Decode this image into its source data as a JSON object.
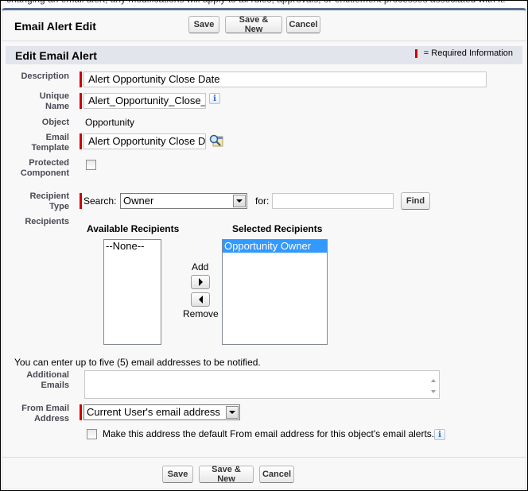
{
  "intro_text": "changing an email alert, any modifications will apply to all rules, approvals, or entitlement processes associated with it.",
  "page_block": {
    "title": "Email Alert Edit",
    "buttons": {
      "save": "Save",
      "save_new": "Save & New",
      "cancel": "Cancel"
    }
  },
  "section": {
    "title": "Edit Email Alert",
    "required_legend": "= Required Information"
  },
  "fields": {
    "description": {
      "label": "Description",
      "value": "Alert Opportunity Close Date",
      "required": true
    },
    "unique_name": {
      "label_line1": "Unique",
      "label_line2": "Name",
      "value": "Alert_Opportunity_Close_",
      "required": true,
      "info_icon": "i"
    },
    "object": {
      "label": "Object",
      "value": "Opportunity"
    },
    "email_template": {
      "label_line1": "Email",
      "label_line2": "Template",
      "value": "Alert Opportunity Close D",
      "required": true
    },
    "protected_component": {
      "label_line1": "Protected",
      "label_line2": "Component",
      "checked": false
    },
    "recipient_type": {
      "label_line1": "Recipient",
      "label_line2": "Type",
      "required": true,
      "search_label": "Search:",
      "search_value": "Owner",
      "for_label": "for:",
      "for_value": "",
      "find_button": "Find"
    },
    "recipients": {
      "label": "Recipients",
      "available_header": "Available Recipients",
      "available_options": [
        "--None--"
      ],
      "add_label": "Add",
      "remove_label": "Remove",
      "selected_header": "Selected Recipients",
      "selected_options": [
        "Opportunity Owner"
      ]
    },
    "additional_emails": {
      "hint": "You can enter up to five (5) email addresses to be notified.",
      "label_line1": "Additional",
      "label_line2": "Emails",
      "value": ""
    },
    "from_email": {
      "label_line1": "From Email",
      "label_line2": "Address",
      "required": true,
      "value": "Current User's email address",
      "default_checkbox_label": "Make this address the default From email address for this object's email alerts.",
      "default_checked": false,
      "info_icon": "i"
    }
  },
  "colors": {
    "required": "#cc0000",
    "header_bar": "#5a6d8e",
    "section_bg": "#e3e5ec",
    "selected_option": "#3399ff"
  }
}
